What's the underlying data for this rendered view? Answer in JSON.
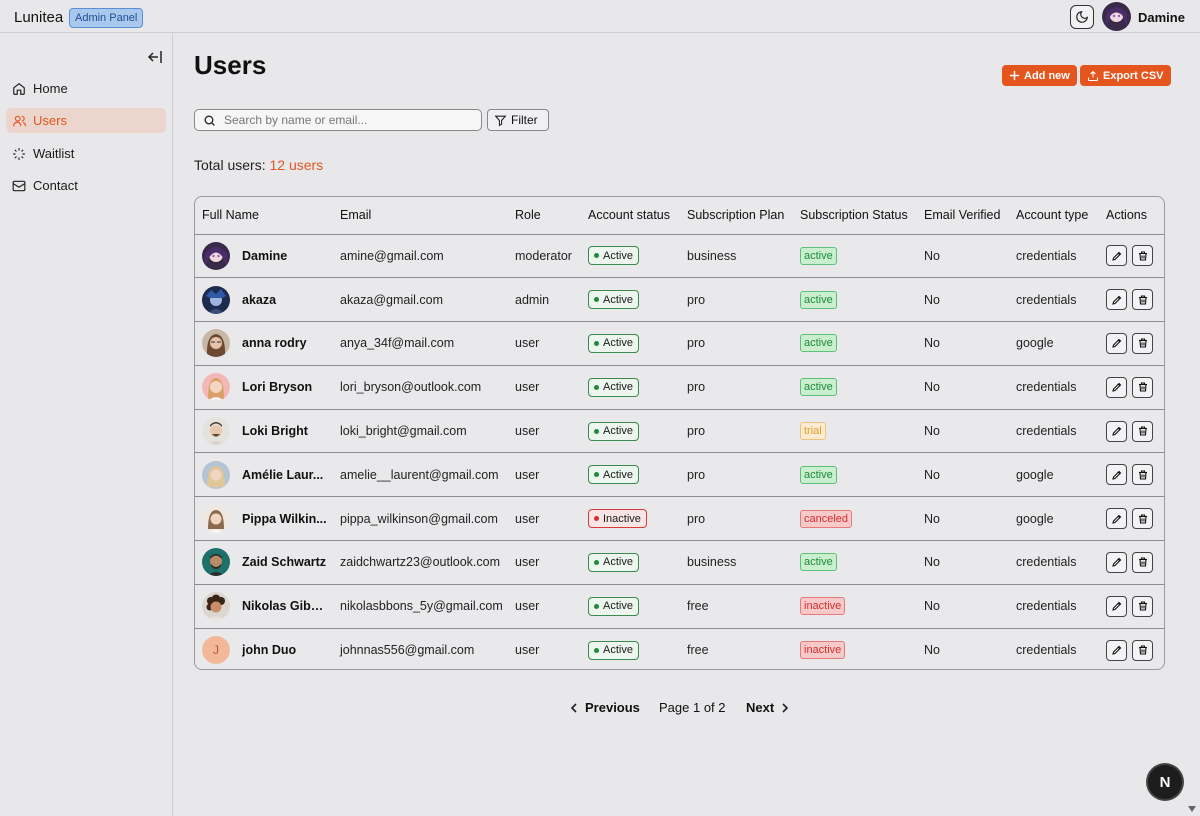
{
  "app": {
    "brand": "Lunitea",
    "panel_badge": "Admin Panel",
    "current_user": "Damine"
  },
  "sidebar": {
    "items": [
      {
        "label": "Home",
        "icon": "home-icon"
      },
      {
        "label": "Users",
        "icon": "users-icon",
        "active": true
      },
      {
        "label": "Waitlist",
        "icon": "loader-icon"
      },
      {
        "label": "Contact",
        "icon": "mail-icon"
      }
    ]
  },
  "main": {
    "title": "Users",
    "add_label": "Add new",
    "export_label": "Export CSV",
    "search_placeholder": "Search by name or email...",
    "filter_label": "Filter",
    "total_label": "Total users:",
    "total_count": "12 users"
  },
  "table": {
    "columns": [
      "Full Name",
      "Email",
      "Role",
      "Account status",
      "Subscription Plan",
      "Subscription Status",
      "Email Verified",
      "Account type",
      "Actions"
    ],
    "rows": [
      {
        "name": "Damine",
        "email": "amine@gmail.com",
        "role": "moderator",
        "status": "Active",
        "plan": "business",
        "sub_status": "active",
        "verified": "No",
        "type": "credentials",
        "avatar": "anime-purple"
      },
      {
        "name": "akaza",
        "email": "akaza@gmail.com",
        "role": "admin",
        "status": "Active",
        "plan": "pro",
        "sub_status": "active",
        "verified": "No",
        "type": "credentials",
        "avatar": "anime-blue"
      },
      {
        "name": "anna rodry",
        "email": "anya_34f@mail.com",
        "role": "user",
        "status": "Active",
        "plan": "pro",
        "sub_status": "active",
        "verified": "No",
        "type": "google",
        "avatar": "photo-brown"
      },
      {
        "name": "Lori Bryson",
        "email": "lori_bryson@outlook.com",
        "role": "user",
        "status": "Active",
        "plan": "pro",
        "sub_status": "active",
        "verified": "No",
        "type": "credentials",
        "avatar": "photo-pink"
      },
      {
        "name": "Loki Bright",
        "email": "loki_bright@gmail.com",
        "role": "user",
        "status": "Active",
        "plan": "pro",
        "sub_status": "trial",
        "verified": "No",
        "type": "credentials",
        "avatar": "photo-light"
      },
      {
        "name": "Amélie Laur...",
        "email": "amelie__laurent@gmail.com",
        "role": "user",
        "status": "Active",
        "plan": "pro",
        "sub_status": "active",
        "verified": "No",
        "type": "google",
        "avatar": "photo-blond"
      },
      {
        "name": "Pippa Wilkin...",
        "email": "pippa_wilkinson@gmail.com",
        "role": "user",
        "status": "Inactive",
        "plan": "pro",
        "sub_status": "canceled",
        "verified": "No",
        "type": "google",
        "avatar": "photo-cream"
      },
      {
        "name": "Zaid Schwartz",
        "email": "zaidchwartz23@outlook.com",
        "role": "user",
        "status": "Active",
        "plan": "business",
        "sub_status": "active",
        "verified": "No",
        "type": "credentials",
        "avatar": "photo-teal"
      },
      {
        "name": "Nikolas Gibb...",
        "email": "nikolasbbons_5y@gmail.com",
        "role": "user",
        "status": "Active",
        "plan": "free",
        "sub_status": "inactive",
        "verified": "No",
        "type": "credentials",
        "avatar": "photo-curly"
      },
      {
        "name": "john Duo",
        "email": "johnnas556@gmail.com",
        "role": "user",
        "status": "Active",
        "plan": "free",
        "sub_status": "inactive",
        "verified": "No",
        "type": "credentials",
        "avatar": "initial",
        "initial": "J"
      }
    ]
  },
  "pagination": {
    "previous": "Previous",
    "page_text": "Page 1 of 2",
    "next": "Next"
  },
  "corner_badge": "N",
  "colors": {
    "accent": "#e4561e",
    "active_green": "#1f8a3a",
    "danger_red": "#d22f2f",
    "trial_orange": "#e79a2b"
  }
}
